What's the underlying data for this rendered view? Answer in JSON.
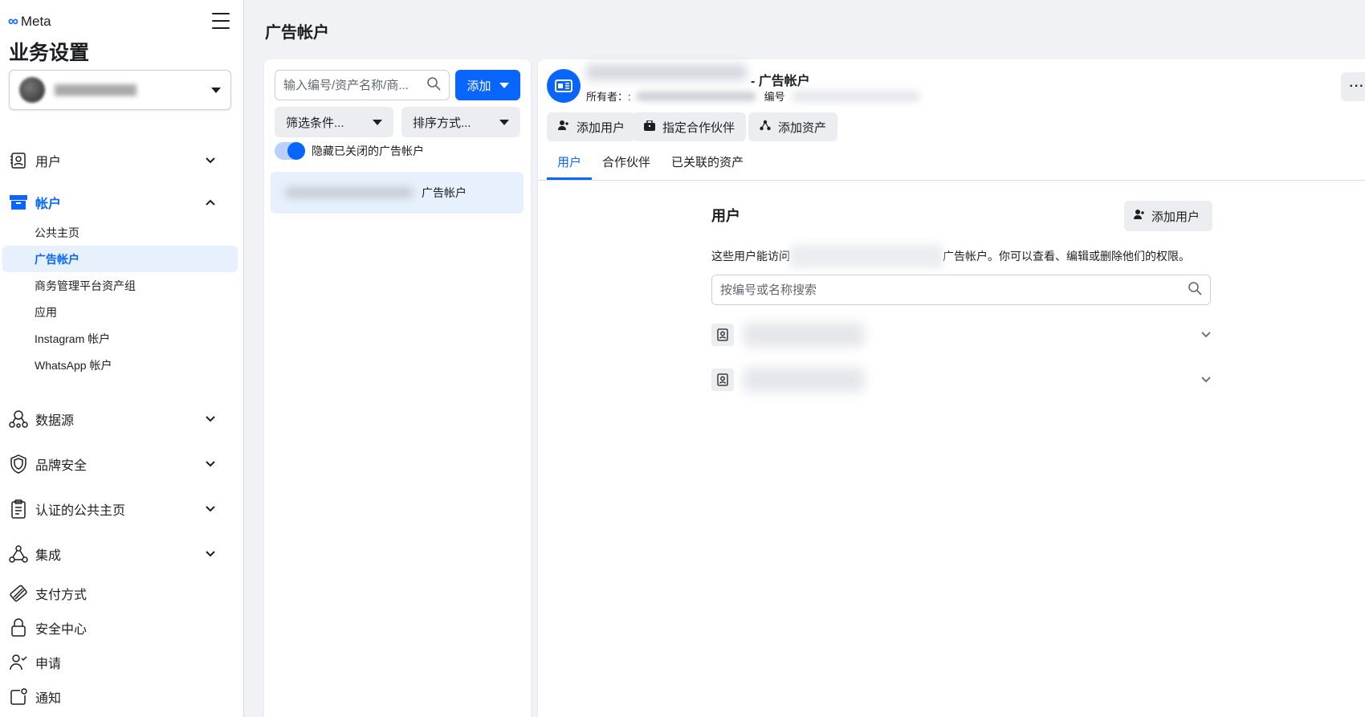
{
  "sidebar": {
    "brand": "Meta",
    "title": "业务设置",
    "nav": {
      "users": "用户",
      "accounts": "帐户",
      "data_sources": "数据源",
      "brand_safety": "品牌安全",
      "verified_pages": "认证的公共主页",
      "integrations": "集成",
      "payment_methods": "支付方式",
      "security_center": "安全中心",
      "requests": "申请",
      "notifications": "通知"
    },
    "sub_items": {
      "pages": "公共主页",
      "ad_accounts": "广告帐户",
      "asset_groups": "商务管理平台资产组",
      "apps": "应用",
      "instagram": "Instagram 帐户",
      "whatsapp": "WhatsApp 帐户"
    }
  },
  "header": {
    "page_title": "广告帐户"
  },
  "list": {
    "search_placeholder": "输入编号/资产名称/商...",
    "add_label": "添加",
    "filter_label": "筛选条件...",
    "sort_label": "排序方式...",
    "toggle_label": "隐藏已关闭的广告帐户",
    "toggle_on": true,
    "selected_item_suffix": "广告帐户"
  },
  "detail": {
    "title_suffix": "- 广告帐户",
    "owner_label": "所有者：:",
    "id_label": "编号",
    "more": "···",
    "actions": {
      "add_user": "添加用户",
      "assign_partner": "指定合作伙伴",
      "add_asset": "添加资产"
    },
    "tabs": {
      "users": "用户",
      "partners": "合作伙伴",
      "linked_assets": "已关联的资产"
    },
    "users_section": {
      "title": "用户",
      "add_user": "添加用户",
      "desc_prefix": "这些用户能访问",
      "desc_suffix": "广告帐户。你可以查看、编辑或删除他们的权限。",
      "search_placeholder": "按编号或名称搜索"
    }
  },
  "colors": {
    "accent": "#0866ff",
    "selected_bg": "#e7f0fd",
    "button_bg": "#ebedf0",
    "page_bg": "#f0f2f5"
  }
}
